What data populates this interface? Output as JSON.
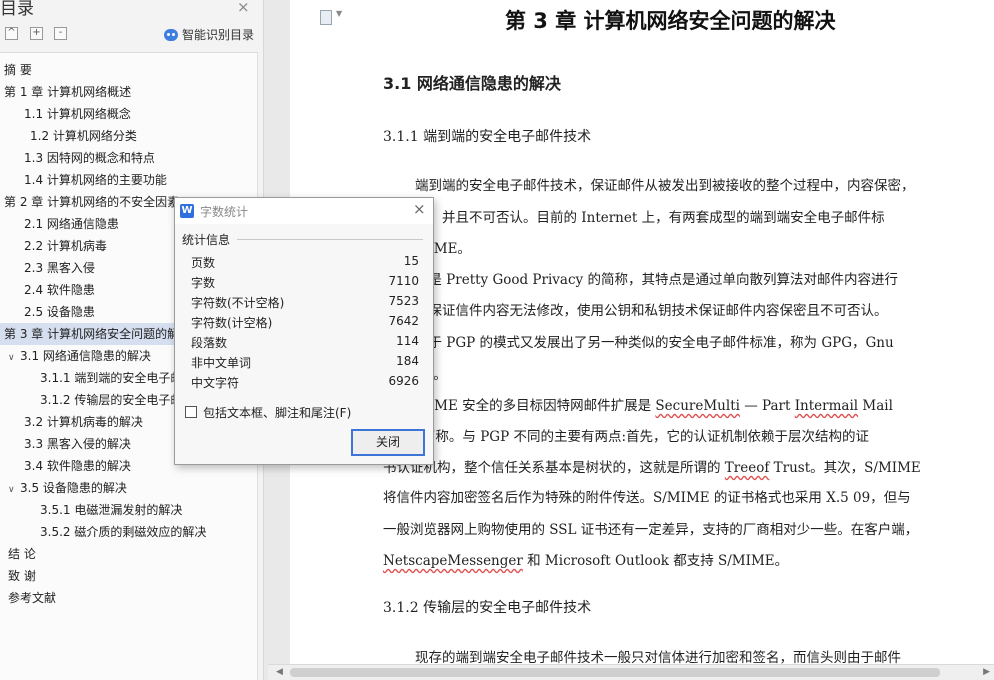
{
  "toc": {
    "title": "目录",
    "close_glyph": "×",
    "expand_glyph": "+",
    "collapse_all_glyph": "^",
    "collapse_glyph": "-",
    "smart_label": "智能识别目录",
    "items": [
      {
        "label": "摘  要",
        "indent": 0,
        "arrow": ""
      },
      {
        "label": "第 1 章  计算机网络概述",
        "indent": 0,
        "arrow": ""
      },
      {
        "label": "1.1  计算机网络概念",
        "indent": 20,
        "arrow": ""
      },
      {
        "label": "1.2  计算机网络分类",
        "indent": 26,
        "arrow": ""
      },
      {
        "label": "1.3  因特网的概念和特点",
        "indent": 20,
        "arrow": ""
      },
      {
        "label": "1.4  计算机网络的主要功能",
        "indent": 20,
        "arrow": ""
      },
      {
        "label": "第 2 章  计算机网络的不安全因素",
        "indent": 0,
        "arrow": ""
      },
      {
        "label": "2.1  网络通信隐患",
        "indent": 20,
        "arrow": ""
      },
      {
        "label": "2.2 计算机病毒",
        "indent": 20,
        "arrow": ""
      },
      {
        "label": "2.3  黑客入侵",
        "indent": 20,
        "arrow": ""
      },
      {
        "label": "2.4  软件隐患",
        "indent": 20,
        "arrow": ""
      },
      {
        "label": "2.5  设备隐患",
        "indent": 20,
        "arrow": ""
      },
      {
        "label": "第 3 章  计算机网络安全问题的解决",
        "indent": 0,
        "arrow": "",
        "selected": true
      },
      {
        "label": "3.1  网络通信隐患的解决",
        "indent": 4,
        "arrow": "∨"
      },
      {
        "label": "3.1.1  端到端的安全电子邮件技术",
        "indent": 36,
        "arrow": ""
      },
      {
        "label": "3.1.2  传输层的安全电子邮件技术",
        "indent": 36,
        "arrow": ""
      },
      {
        "label": "3.2  计算机病毒的解决",
        "indent": 20,
        "arrow": ""
      },
      {
        "label": "3.3  黑客入侵的解决",
        "indent": 20,
        "arrow": ""
      },
      {
        "label": "3.4  软件隐患的解决",
        "indent": 20,
        "arrow": ""
      },
      {
        "label": "3.5  设备隐患的解决",
        "indent": 4,
        "arrow": "∨"
      },
      {
        "label": "3.5.1  电磁泄漏发射的解决",
        "indent": 36,
        "arrow": ""
      },
      {
        "label": "3.5.2  磁介质的剩磁效应的解决",
        "indent": 36,
        "arrow": ""
      },
      {
        "label": "结     论",
        "indent": 4,
        "arrow": ""
      },
      {
        "label": "致     谢",
        "indent": 4,
        "arrow": ""
      },
      {
        "label": "参考文献",
        "indent": 4,
        "arrow": ""
      }
    ]
  },
  "doc": {
    "chapter_title": "第 3 章  计算机网络安全问题的解决",
    "section_heading": "3.1  网络通信隐患的解决",
    "sub1": "3.1.1 端到端的安全电子邮件技术",
    "sub2": "3.1.2 传输层的安全电子邮件技术",
    "lines": [
      "端到端的安全电子邮件技术，保证邮件从被发出到被接收的整个过程中，内容保密，",
      "改，并且不可否认。目前的 Internet 上，有两套成型的端到端安全电子邮件标",
      "和 S/MIME。",
      "P 是 Pretty Good Privacy 的简称，其特点是通过单向散列算法对邮件内容进行",
      "以保证信件内容无法修改，使用公钥和私钥技术保证邮件内容保密且不可否认。",
      "基于 PGP 的模式又发展出了另一种类似的安全电子邮件标准，称为 GPG，Gnu",
      "yGuard。",
      "MIME 安全的多目标因特网邮件扩展是 SecureMulti — Part Intermail Mail",
      "ion 的简称。与 PGP 不同的主要有两点:首先，它的认证机制依赖于层次结构的证",
      "书认证机构，整个信任关系基本是树状的，这就是所谓的 Treeof Trust。其次，S/MIME",
      "将信件内容加密签名后作为特殊的附件传送。S/MIME 的证书格式也采用 X.5 09，但与",
      "一般浏览器网上购物使用的 SSL 证书还有一定差异，支持的厂商相对少一些。在客户端，",
      "NetscapeMessenger 和 Microsoft Outlook 都支持 S/MIME。"
    ],
    "last_line": "现存的端到端安全电子邮件技术一般只对信体进行加密和签名，而信头则由于邮件"
  },
  "scroll": {
    "left_glyph": "◀",
    "right_glyph": "▶"
  },
  "wordcount": {
    "title": "字数统计",
    "close_glyph": "×",
    "app_icon_glyph": "W",
    "group_label": "统计信息",
    "stats": [
      {
        "key": "页数",
        "value": "15"
      },
      {
        "key": "字数",
        "value": "7110"
      },
      {
        "key": "字符数(不计空格)",
        "value": "7523"
      },
      {
        "key": "字符数(计空格)",
        "value": "7642"
      },
      {
        "key": "段落数",
        "value": "114"
      },
      {
        "key": "非中文单词",
        "value": "184"
      },
      {
        "key": "中文字符",
        "value": "6926"
      }
    ],
    "checkbox_label": "包括文本框、脚注和尾注(F)",
    "close_button": "关闭"
  }
}
